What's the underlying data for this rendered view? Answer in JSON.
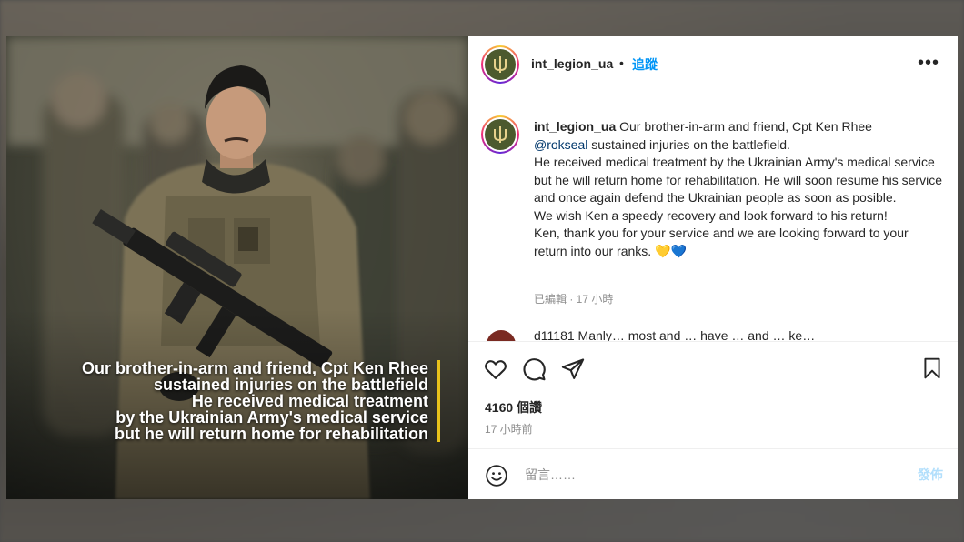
{
  "post_image": {
    "alt_caption_lines": [
      "Our brother-in-arm and friend, Cpt Ken Rhee",
      "sustained injuries on the battlefield",
      "He received medical treatment",
      "by the Ukrainian Army's medical service",
      "but he will return home for rehabilitation"
    ]
  },
  "header": {
    "username": "int_legion_ua",
    "separator": "•",
    "follow_label": "追蹤",
    "more_icon": "more-horizontal-icon"
  },
  "caption": {
    "username": "int_legion_ua",
    "line1": " Our brother-in-arm and friend, Cpt Ken Rhee",
    "mention": "@rokseal",
    "line2": " sustained injuries on the battlefield.",
    "line3": "He received medical treatment by the Ukrainian Army's medical service but he will return home for rehabilitation. He will soon resume his service and once again defend the Ukrainian people as soon as posible.",
    "line4": "We wish Ken a speedy recovery and look forward to his return!",
    "line5": "Ken, thank you for your service and we are looking forward to your return into our ranks. ",
    "heart_yellow": "💛",
    "heart_blue": "💙",
    "edited": "已編輯 · 17 小時"
  },
  "comment_peek": {
    "text": "d11181 Manly… most and … have … and … ke…"
  },
  "actions": {
    "like_icon": "heart-icon",
    "comment_icon": "comment-icon",
    "share_icon": "send-icon",
    "save_icon": "bookmark-icon",
    "views": "4160 個讚",
    "time": "17 小時前"
  },
  "comment_input": {
    "emoji_icon": "emoji-icon",
    "placeholder": "留言……",
    "post_label": "發佈"
  },
  "colors": {
    "link": "#0095f6",
    "mention": "#00376b",
    "muted": "#8e8e8e",
    "caption_accent": "#e8c21b"
  }
}
